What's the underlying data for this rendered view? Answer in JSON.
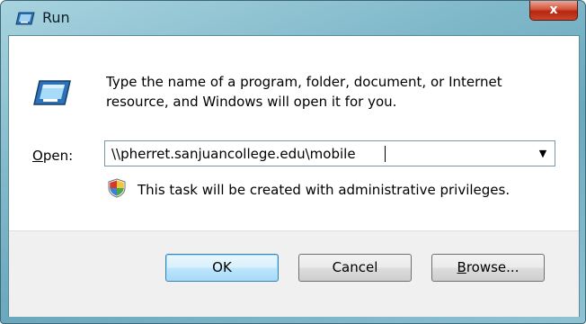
{
  "window": {
    "title": "Run",
    "close_glyph": "x"
  },
  "dialog": {
    "description": "Type the name of a program, folder, document, or Internet resource, and Windows will open it for you.",
    "open_label_accel": "O",
    "open_label_rest": "pen:",
    "open_value": "\\\\pherret.sanjuancollege.edu\\mobile",
    "dropdown_glyph": "▼",
    "admin_note": "This task will be created with administrative privileges."
  },
  "buttons": {
    "ok": "OK",
    "cancel": "Cancel",
    "browse_accel": "B",
    "browse_rest": "rowse..."
  },
  "icons": {
    "title": "run-icon",
    "run": "run-icon",
    "shield": "uac-shield-icon",
    "close": "close-icon",
    "dropdown": "chevron-down-icon"
  },
  "colors": {
    "ok_border": "#3c7fb1",
    "close_red": "#c9442c"
  }
}
